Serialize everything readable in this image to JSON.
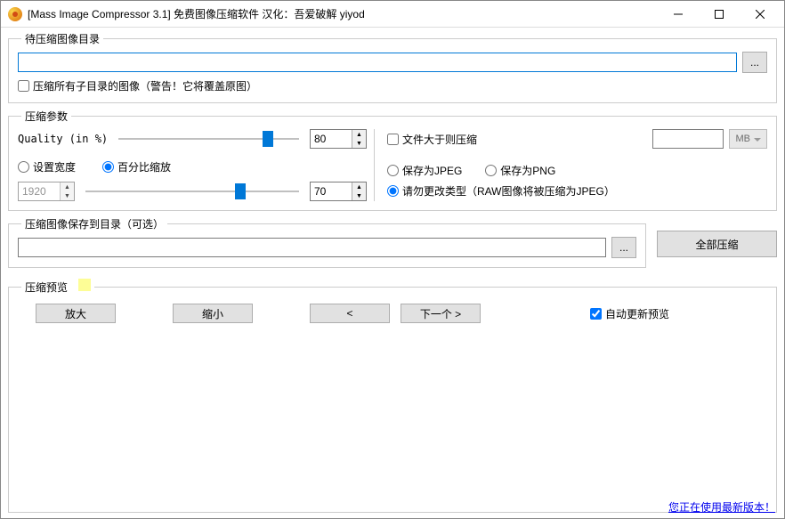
{
  "window": {
    "title": "[Mass Image Compressor 3.1] 免费图像压缩软件 汉化：吾爱破解 yiyod"
  },
  "source": {
    "legend": "待压缩图像目录",
    "path": "",
    "browse": "...",
    "recurse_label": "压缩所有子目录的图像（警告！它将覆盖原图）",
    "recurse_checked": false
  },
  "params": {
    "legend": "压缩参数",
    "quality_label": "Quality (in %)",
    "quality_value": "80",
    "width_radio": "设置宽度",
    "scale_radio": "百分比缩放",
    "scale_selected": "scale",
    "width_value": "1920",
    "scale_value": "70",
    "size_gate_checked": false,
    "size_gate_label": "文件大于则压缩",
    "size_value": "",
    "size_unit": "MB",
    "save_jpeg": "保存为JPEG",
    "save_png": "保存为PNG",
    "save_keep": "请勿更改类型（RAW图像将被压缩为JPEG）",
    "save_selected": "keep"
  },
  "output": {
    "legend": "压缩图像保存到目录（可选）",
    "path": "",
    "browse": "...",
    "compress_all": "全部压缩"
  },
  "preview": {
    "legend": "压缩预览",
    "zoom_in": "放大",
    "zoom_out": "缩小",
    "prev": "<",
    "next": "下一个  >",
    "auto_label": "自动更新预览",
    "auto_checked": true
  },
  "footer": {
    "version_link": "您正在使用最新版本！"
  }
}
